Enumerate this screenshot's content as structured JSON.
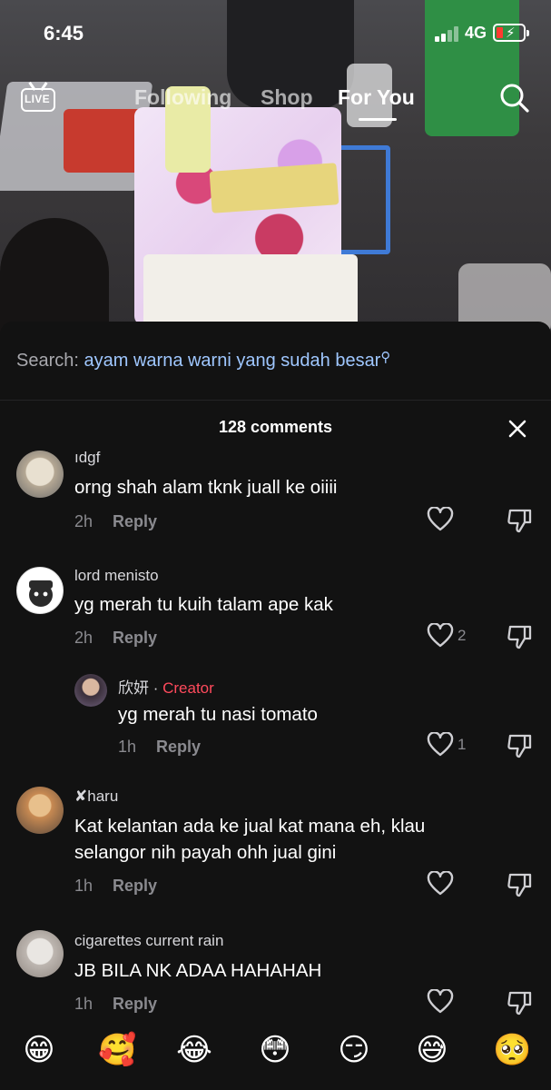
{
  "status_bar": {
    "time": "6:45",
    "network": "4G",
    "battery_color": "#ff3b30"
  },
  "top_nav": {
    "live_label": "LIVE",
    "tabs": [
      {
        "label": "Following",
        "active": false
      },
      {
        "label": "Shop",
        "active": false
      },
      {
        "label": "For You",
        "active": true
      }
    ],
    "search_icon": "search-icon"
  },
  "sheet": {
    "search_prefix": "Search:",
    "search_query": "ayam warna warni yang sudah besar",
    "comment_count": "128 comments",
    "close_icon": "close-icon",
    "comments": [
      {
        "username": "ıdgf",
        "text": "orng shah alam tknk juall ke oiiii",
        "time": "2h",
        "reply_label": "Reply",
        "likes": ""
      },
      {
        "username": "lord menisto",
        "text": "yg merah tu kuih talam ape kak",
        "time": "2h",
        "reply_label": "Reply",
        "likes": "2"
      },
      {
        "username": "欣妍",
        "badge": "Creator",
        "separator": " · ",
        "text": "yg merah tu nasi tomato",
        "time": "1h",
        "reply_label": "Reply",
        "likes": "1",
        "is_reply": true
      },
      {
        "username": "✘haru",
        "text": "Kat kelantan ada ke jual kat mana eh, klau selangor nih payah ohh jual gini",
        "time": "1h",
        "reply_label": "Reply",
        "likes": ""
      },
      {
        "username": "cigarettes current rain",
        "text": "JB BILA NK ADAA HAHAHAH",
        "time": "1h",
        "reply_label": "Reply",
        "likes": ""
      }
    ]
  },
  "emoji_bar": [
    "😁",
    "🥰",
    "😂",
    "😳",
    "😏",
    "😅",
    "🥺"
  ]
}
